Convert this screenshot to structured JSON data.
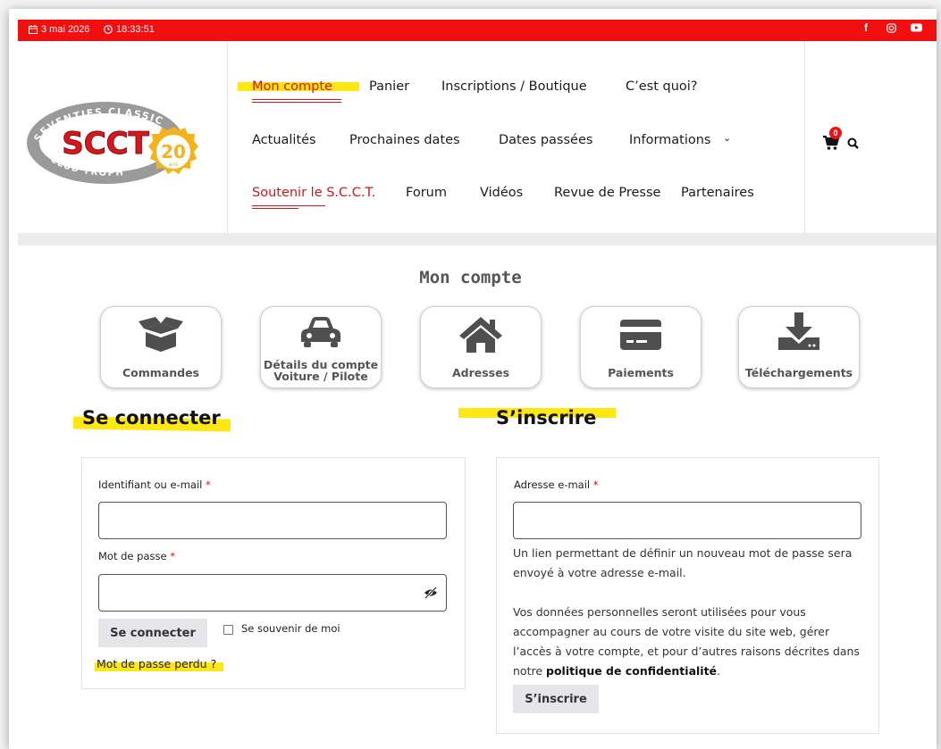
{
  "topbar": {
    "date": "3 mai 2026",
    "time": "18:33:51",
    "social": [
      "facebook-icon",
      "instagram-icon",
      "youtube-icon"
    ]
  },
  "logo": {
    "letters": "SCCT",
    "ring_top": "SEVENTIES CLASSIC",
    "ring_bottom": "CLUB TROPH",
    "anniversary": "20",
    "anniversary_unit": "ans"
  },
  "nav": {
    "row1": [
      "Mon compte",
      "Panier",
      "Inscriptions / Boutique",
      "C’est quoi?"
    ],
    "row2": [
      "Actualités",
      "Prochaines dates",
      "Dates passées",
      "Informations"
    ],
    "row3": [
      "Soutenir le S.C.C.T.",
      "Forum",
      "Vidéos",
      "Revue de Presse",
      "Partenaires"
    ],
    "cart_count": "0"
  },
  "page_title": "Mon compte",
  "tiles": [
    {
      "label": "Commandes",
      "icon": "box-icon"
    },
    {
      "label": "Détails du compte\nVoiture / Pilote",
      "icon": "car-icon"
    },
    {
      "label": "Adresses",
      "icon": "home-icon"
    },
    {
      "label": "Paiements",
      "icon": "credit-card-icon"
    },
    {
      "label": "Téléchargements",
      "icon": "download-icon"
    }
  ],
  "login": {
    "heading": "Se connecter",
    "username_label": "Identifiant ou e-mail",
    "password_label": "Mot de passe",
    "submit": "Se connecter",
    "remember": "Se souvenir de moi",
    "lost_password": "Mot de passe perdu",
    "lost_suffix": " ?"
  },
  "register": {
    "heading": "S’inscrire",
    "email_label": "Adresse e-mail",
    "info": "Un lien permettant de définir un nouveau mot de passe sera envoyé à votre adresse e-mail.",
    "privacy_text": "Vos données personnelles seront utilisées pour vous accompagner au cours de votre visite du site web, gérer l’accès à votre compte, et pour d’autres raisons décrites dans notre ",
    "privacy_link": "politique de confidentialité",
    "privacy_end": ".",
    "submit": "S’inscrire"
  },
  "colors": {
    "topbar": "#f20f0f",
    "highlight": "#ffe812",
    "active_link": "#d41616",
    "logo_red": "#d8161d",
    "logo_gold": "#f5b21a"
  }
}
